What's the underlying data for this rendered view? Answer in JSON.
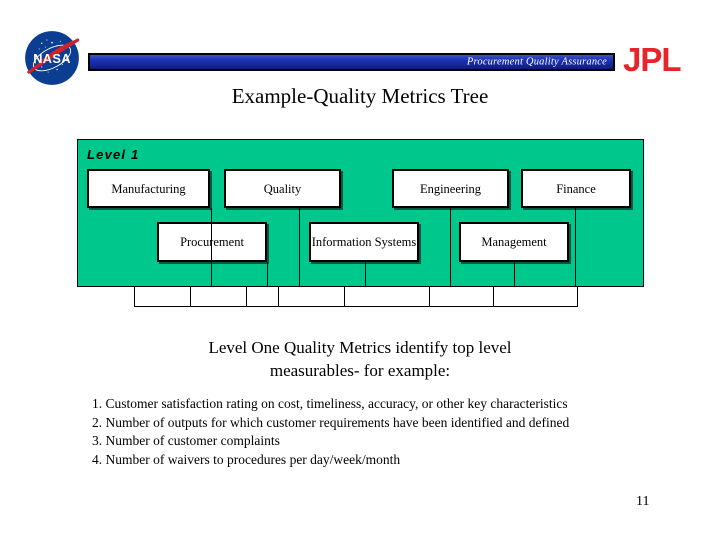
{
  "header": {
    "banner_text": "Procurement Quality Assurance",
    "nasa_logo_alt": "NASA",
    "nasa_wordmark": "NASA",
    "jpl_logo_text": "JPL",
    "banner_color": "#1d33b4",
    "jpl_color": "#e8232a",
    "nasa_blue": "#0b3d91",
    "nasa_red": "#d4202b"
  },
  "slide": {
    "title": "Example-Quality Metrics Tree",
    "page_number": "11"
  },
  "diagram": {
    "panel_color": "#00c88c",
    "level_label": "Level 1",
    "row1": [
      {
        "label": "Manufacturing"
      },
      {
        "label": "Quality"
      },
      {
        "label": "Engineering"
      },
      {
        "label": "Finance"
      }
    ],
    "row2": [
      {
        "label": "Procurement"
      },
      {
        "label": "Information Systems"
      },
      {
        "label": "Management"
      }
    ]
  },
  "caption": {
    "line1": "Level One Quality Metrics identify top level",
    "line2": "measurables- for example:"
  },
  "bullets": [
    "1. Customer satisfaction rating on cost, timeliness, accuracy, or other key characteristics",
    "2. Number of outputs for which customer requirements have been identified and defined",
    "3. Number of customer complaints",
    "4. Number of waivers to procedures per day/week/month"
  ]
}
